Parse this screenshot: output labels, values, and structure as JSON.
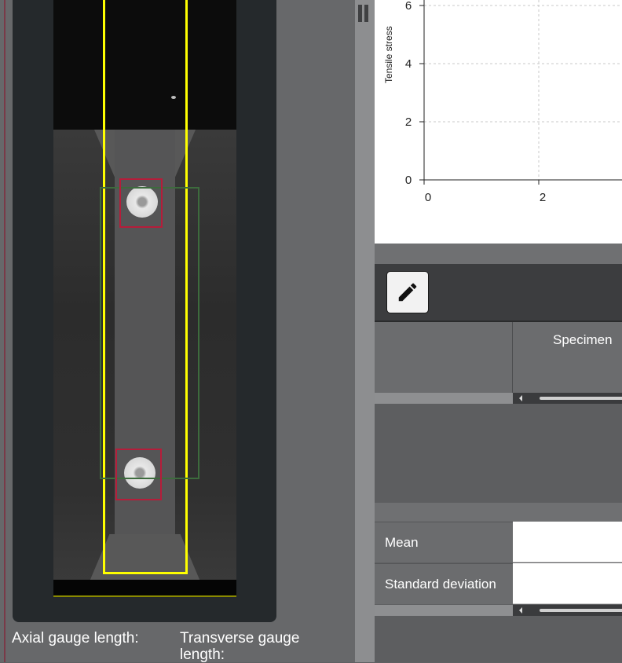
{
  "video_panel": {
    "axial_label": "Axial gauge length:",
    "transverse_label": "Transverse gauge length:"
  },
  "chart": {
    "y_axis_title": "Tensile stress",
    "y_ticks": [
      "0",
      "2",
      "4",
      "6"
    ],
    "x_ticks": [
      "0",
      "2"
    ]
  },
  "chart_data": {
    "type": "line",
    "title": "",
    "xlabel": "",
    "ylabel": "Tensile stress",
    "series": [],
    "x_ticks": [
      0,
      2
    ],
    "y_ticks": [
      0,
      2,
      4,
      6
    ],
    "xlim": [
      0,
      4
    ],
    "ylim": [
      0,
      6
    ],
    "grid": true
  },
  "results_table": {
    "column_header": "Specimen",
    "rows": [
      {
        "label": "Mean",
        "value": ""
      },
      {
        "label": "Standard deviation",
        "value": ""
      }
    ]
  },
  "icons": {
    "edit": "pencil-icon"
  },
  "colors": {
    "axial_box": "#ffff00",
    "transverse_box": "#3d6b3d",
    "marker_box": "#b51d3a",
    "gauge_strip": "#8a8a00"
  }
}
